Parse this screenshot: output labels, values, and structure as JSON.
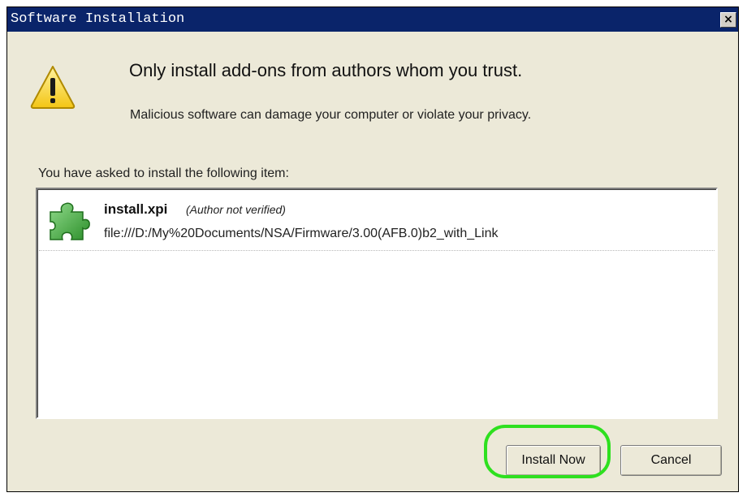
{
  "window": {
    "title": "Software Installation",
    "close_glyph": "×"
  },
  "warning": {
    "icon": "warning-triangle-icon",
    "headline": "Only install add-ons from authors whom you trust.",
    "subline": "Malicious software can damage your computer or violate your privacy."
  },
  "list": {
    "label": "You have asked to install the following item:",
    "items": [
      {
        "icon": "puzzle-piece-icon",
        "name": "install.xpi",
        "author": "(Author not verified)",
        "url": "file:///D:/My%20Documents/NSA/Firmware/3.00(AFB.0)b2_with_Link"
      }
    ]
  },
  "buttons": {
    "install": "Install Now",
    "cancel": "Cancel"
  },
  "colors": {
    "titlebar": "#0a246a",
    "dialog_bg": "#ece9d8",
    "highlight": "#2ee01f",
    "warning_yellow": "#f7d21c",
    "puzzle_green": "#3fae3a"
  }
}
